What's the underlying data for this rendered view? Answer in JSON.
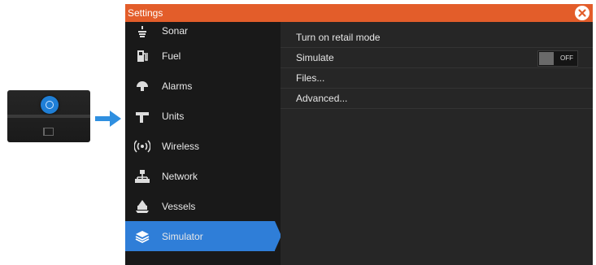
{
  "window": {
    "title": "Settings",
    "close_label": "⊗"
  },
  "sidebar": {
    "items": [
      {
        "label": "Sonar",
        "icon": "sonar-icon"
      },
      {
        "label": "Fuel",
        "icon": "fuel-pump-icon"
      },
      {
        "label": "Alarms",
        "icon": "alarm-icon"
      },
      {
        "label": "Units",
        "icon": "units-icon"
      },
      {
        "label": "Wireless",
        "icon": "wireless-icon"
      },
      {
        "label": "Network",
        "icon": "network-icon"
      },
      {
        "label": "Vessels",
        "icon": "vessel-icon"
      },
      {
        "label": "Simulator",
        "icon": "simulator-layers-icon",
        "active": true
      }
    ]
  },
  "content": {
    "rows": [
      {
        "label": "Turn on retail mode"
      },
      {
        "label": "Simulate",
        "toggle": "OFF"
      },
      {
        "label": "Files..."
      },
      {
        "label": "Advanced..."
      }
    ]
  },
  "colors": {
    "titlebar": "#e35d2a",
    "active_item": "#2f7ed8",
    "arrow": "#2f8fe0"
  }
}
